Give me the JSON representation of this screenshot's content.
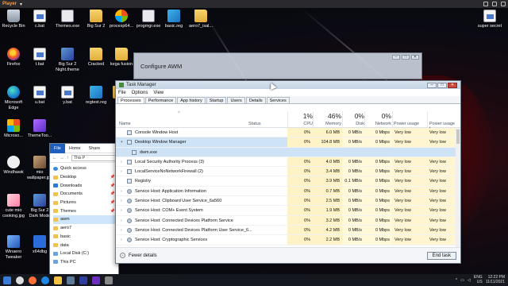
{
  "player": {
    "name": "Player",
    "menu_arrow": "▾"
  },
  "desktop_icons": [
    {
      "label": "Recycle Bin",
      "icon": "bin"
    },
    {
      "label": "c.bat",
      "icon": "bat"
    },
    {
      "label": "Themes.exe",
      "icon": "exe"
    },
    {
      "label": "Big Sur 2",
      "icon": "folder"
    },
    {
      "label": "procexp64...",
      "icon": "proc"
    },
    {
      "label": "progmgr.exe",
      "icon": "exe"
    },
    {
      "label": "basic.reg",
      "icon": "reg"
    },
    {
      "label": "aero7_isal...",
      "icon": "folder"
    },
    {
      "label": "super secret",
      "icon": "bat"
    },
    {
      "label": "Firefox",
      "icon": "firefox"
    },
    {
      "label": "t.bat",
      "icon": "bat"
    },
    {
      "label": "Big Sur 2 Night.theme",
      "icon": "theme"
    },
    {
      "label": "Cracked",
      "icon": "folder"
    },
    {
      "label": "kega fusion",
      "icon": "folder"
    },
    {
      "label": "Microsoft Edge",
      "icon": "edge"
    },
    {
      "label": "u.bat",
      "icon": "bat"
    },
    {
      "label": "y.bat",
      "icon": "bat"
    },
    {
      "label": "regtest.reg",
      "icon": "reg"
    },
    {
      "label": "W",
      "icon": "folder"
    },
    {
      "label": "Microso...",
      "icon": "ms"
    },
    {
      "label": "ThemeToo...",
      "icon": "purple"
    },
    {
      "label": "Windhawk",
      "icon": "hawk"
    },
    {
      "label": "mio wallpaper.jpg",
      "icon": "img"
    },
    {
      "label": "cute mio cooking.jpg",
      "icon": "cutemio"
    },
    {
      "label": "Big Sur 2 Dark Mode",
      "icon": "theme"
    },
    {
      "label": "Winaero Tweaker",
      "icon": "win"
    },
    {
      "label": "x64dbg",
      "icon": "blue"
    }
  ],
  "awm": {
    "title": "Configure AWM",
    "minimize": "─",
    "maximize": "□",
    "close": "✕"
  },
  "explorer": {
    "tabs": [
      "File",
      "Home",
      "Share"
    ],
    "address": "This P",
    "nav": [
      {
        "label": "Quick access",
        "icon": "star"
      },
      {
        "label": "Desktop",
        "icon": "folder",
        "pinned": true
      },
      {
        "label": "Downloads",
        "icon": "download",
        "pinned": true
      },
      {
        "label": "Documents",
        "icon": "doc",
        "pinned": true
      },
      {
        "label": "Pictures",
        "icon": "pic",
        "pinned": true
      },
      {
        "label": "Themes",
        "icon": "folder",
        "pinned": true
      },
      {
        "label": "awm",
        "icon": "folder",
        "selected": true
      },
      {
        "label": "aero7",
        "icon": "folder"
      },
      {
        "label": "basic",
        "icon": "folder"
      },
      {
        "label": "data",
        "icon": "folder"
      },
      {
        "label": "Local Disk (C:)",
        "icon": "drive"
      },
      {
        "label": "This PC",
        "icon": "pc"
      }
    ],
    "pin_glyph": "📌"
  },
  "taskmanager": {
    "title": "Task Manager",
    "menu": [
      "File",
      "Options",
      "View"
    ],
    "tabs": [
      "Processes",
      "Performance",
      "App history",
      "Startup",
      "Users",
      "Details",
      "Services"
    ],
    "active_tab": "Processes",
    "sort_glyph": "^",
    "columns": {
      "name": "Name",
      "status": "Status",
      "cpu": {
        "pct": "1%",
        "label": "CPU"
      },
      "memory": {
        "pct": "46%",
        "label": "Memory"
      },
      "disk": {
        "pct": "0%",
        "label": "Disk"
      },
      "network": {
        "pct": "0%",
        "label": "Network"
      },
      "power": "Power usage",
      "power_trend": "Power usage t..."
    },
    "rows": [
      {
        "name": "Console Window Host",
        "expand": "",
        "cpu": "0%",
        "mem": "6.0 MB",
        "disk": "0 MB/s",
        "net": "0 Mbps",
        "power": "Very low",
        "trend": "Very low",
        "icon": "window"
      },
      {
        "name": "Desktop Window Manager",
        "expand": "▾",
        "cpu": "0%",
        "mem": "104.8 MB",
        "disk": "0 MB/s",
        "net": "0 Mbps",
        "power": "Very low",
        "trend": "Very low",
        "icon": "window",
        "selected": true
      },
      {
        "name": "dwm.exe",
        "expand": "",
        "child": true,
        "cpu": "",
        "mem": "",
        "disk": "",
        "net": "",
        "power": "",
        "trend": "",
        "icon": "window",
        "selected": true
      },
      {
        "name": "Local Security Authority Process (3)",
        "expand": "›",
        "cpu": "0%",
        "mem": "4.0 MB",
        "disk": "0 MB/s",
        "net": "0 Mbps",
        "power": "Very low",
        "trend": "Very low",
        "icon": "window"
      },
      {
        "name": "LocalServiceNoNetworkFirewall (2)",
        "expand": "›",
        "cpu": "0%",
        "mem": "3.4 MB",
        "disk": "0 MB/s",
        "net": "0 Mbps",
        "power": "Very low",
        "trend": "Very low",
        "icon": "window"
      },
      {
        "name": "Registry",
        "expand": "",
        "cpu": "0%",
        "mem": "3.9 MB",
        "disk": "0.1 MB/s",
        "net": "0 Mbps",
        "power": "Very low",
        "trend": "Very low",
        "icon": "window"
      },
      {
        "name": "Service Host: Application Information",
        "expand": "›",
        "cpu": "0%",
        "mem": "0.7 MB",
        "disk": "0 MB/s",
        "net": "0 Mbps",
        "power": "Very low",
        "trend": "Very low",
        "icon": "gear"
      },
      {
        "name": "Service Host: Clipboard User Service_6a560",
        "expand": "›",
        "cpu": "0%",
        "mem": "2.5 MB",
        "disk": "0 MB/s",
        "net": "0 Mbps",
        "power": "Very low",
        "trend": "Very low",
        "icon": "gear"
      },
      {
        "name": "Service Host: COM+ Event System",
        "expand": "›",
        "cpu": "0%",
        "mem": "1.9 MB",
        "disk": "0 MB/s",
        "net": "0 Mbps",
        "power": "Very low",
        "trend": "Very low",
        "icon": "gear"
      },
      {
        "name": "Service Host: Connected Devices Platform Service",
        "expand": "›",
        "cpu": "0%",
        "mem": "3.2 MB",
        "disk": "0 MB/s",
        "net": "0 Mbps",
        "power": "Very low",
        "trend": "Very low",
        "icon": "gear"
      },
      {
        "name": "Service Host: Connected Devices Platform User Service_6...",
        "expand": "›",
        "cpu": "0%",
        "mem": "4.2 MB",
        "disk": "0 MB/s",
        "net": "0 Mbps",
        "power": "Very low",
        "trend": "Very low",
        "icon": "gear"
      },
      {
        "name": "Service Host: Cryptographic Services",
        "expand": "›",
        "cpu": "0%",
        "mem": "2.2 MB",
        "disk": "0 MB/s",
        "net": "0 Mbps",
        "power": "Very low",
        "trend": "Very low",
        "icon": "gear"
      }
    ],
    "fewer_details": "Fewer details",
    "end_task": "End task",
    "window_controls": {
      "minimize": "─",
      "maximize": "□",
      "close": "✕"
    }
  },
  "taskbar": {
    "tray_lang": "ENG",
    "tray_region": "US",
    "time": "12:22 PM",
    "date": "11/11/2021"
  }
}
